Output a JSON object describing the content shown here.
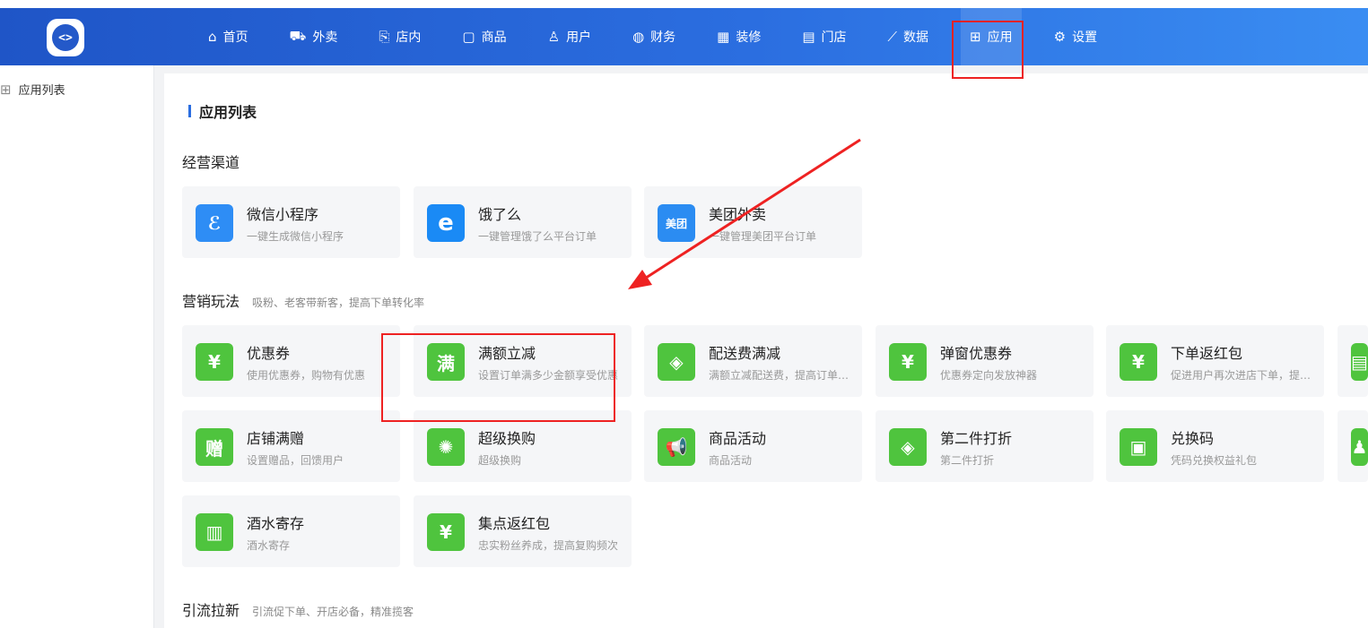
{
  "nav": [
    {
      "label": "首页",
      "icon": "⌂"
    },
    {
      "label": "外卖",
      "icon": "⛟"
    },
    {
      "label": "店内",
      "icon": "⎘"
    },
    {
      "label": "商品",
      "icon": "▢"
    },
    {
      "label": "用户",
      "icon": "♙"
    },
    {
      "label": "财务",
      "icon": "◍"
    },
    {
      "label": "装修",
      "icon": "▦"
    },
    {
      "label": "门店",
      "icon": "▤"
    },
    {
      "label": "数据",
      "icon": "⟋"
    },
    {
      "label": "应用",
      "icon": "⊞"
    },
    {
      "label": "设置",
      "icon": "⚙"
    }
  ],
  "sidebar": {
    "item_label": "应用列表",
    "item_icon": "⊞"
  },
  "page_title": "应用列表",
  "sections": [
    {
      "title": "经营渠道",
      "sub": ""
    },
    {
      "title": "营销玩法",
      "sub": "吸粉、老客带新客，提高下单转化率"
    },
    {
      "title": "引流拉新",
      "sub": "引流促下单、开店必备，精准揽客"
    }
  ],
  "channel_cards": [
    {
      "name": "微信小程序",
      "desc": "一键生成微信小程序",
      "icon": "ℰ",
      "color": "#2e8df5"
    },
    {
      "name": "饿了么",
      "desc": "一键管理饿了么平台订单",
      "icon": "e",
      "color": "#1a8af5"
    },
    {
      "name": "美团外卖",
      "desc": "一键管理美团平台订单",
      "icon": "美团",
      "color": "#2b8cf2"
    }
  ],
  "marketing_cards": [
    {
      "name": "优惠券",
      "desc": "使用优惠券，购物有优惠",
      "icon": "¥",
      "color": "#4fc43e"
    },
    {
      "name": "满额立减",
      "desc": "设置订单满多少金额享受优惠",
      "icon": "满",
      "color": "#4fc43e"
    },
    {
      "name": "配送费满减",
      "desc": "满额立减配送费，提高订单转化",
      "icon": "◈",
      "color": "#4fc43e"
    },
    {
      "name": "弹窗优惠券",
      "desc": "优惠券定向发放神器",
      "icon": "¥",
      "color": "#4fc43e"
    },
    {
      "name": "下单返红包",
      "desc": "促进用户再次进店下单，提高复购",
      "icon": "¥",
      "color": "#4fc43e"
    },
    {
      "name": "店铺满赠",
      "desc": "设置赠品，回馈用户",
      "icon": "赠",
      "color": "#4fc43e"
    },
    {
      "name": "超级换购",
      "desc": "超级换购",
      "icon": "✺",
      "color": "#4fc43e"
    },
    {
      "name": "商品活动",
      "desc": "商品活动",
      "icon": "📢",
      "color": "#4fc43e"
    },
    {
      "name": "第二件打折",
      "desc": "第二件打折",
      "icon": "◈",
      "color": "#4fc43e"
    },
    {
      "name": "兑换码",
      "desc": "凭码兑换权益礼包",
      "icon": "▣",
      "color": "#4fc43e"
    },
    {
      "name": "酒水寄存",
      "desc": "酒水寄存",
      "icon": "▥",
      "color": "#4fc43e"
    },
    {
      "name": "集点返红包",
      "desc": "忠实粉丝养成，提高复购频次",
      "icon": "¥",
      "color": "#4fc43e"
    }
  ],
  "partial_cards": [
    {
      "icon": "▤",
      "color": "#4fc43e"
    },
    {
      "icon": "♟",
      "color": "#4fc43e"
    }
  ],
  "annotation_color": "#ee2222"
}
